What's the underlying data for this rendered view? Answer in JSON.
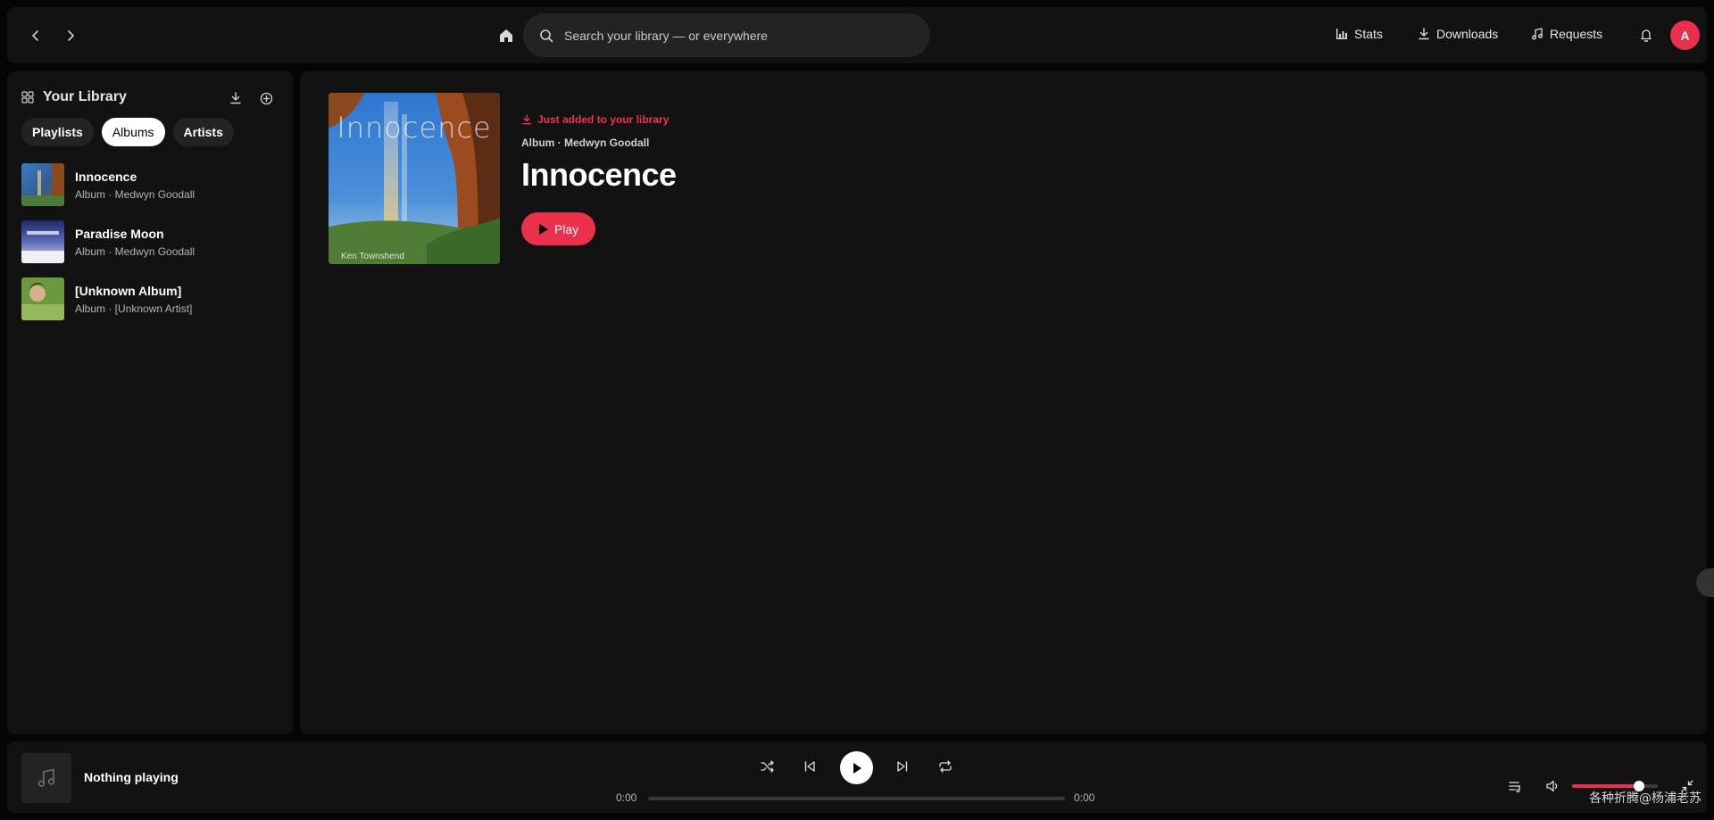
{
  "topbar": {
    "search_placeholder": "Search your library — or everywhere",
    "links": {
      "stats": "Stats",
      "downloads": "Downloads",
      "requests": "Requests"
    },
    "avatar_initial": "A"
  },
  "sidebar": {
    "title": "Your Library",
    "filters": [
      "Playlists",
      "Albums",
      "Artists"
    ],
    "active_filter": "Albums",
    "items": [
      {
        "name": "Innocence",
        "subtitle": "Album · Medwyn Goodall",
        "thumb_icon": "waterfall-cover"
      },
      {
        "name": "Paradise Moon",
        "subtitle": "Album · Medwyn Goodall",
        "thumb_icon": "moon-cover"
      },
      {
        "name": "[Unknown Album]",
        "subtitle": "Album · [Unknown Artist]",
        "thumb_icon": "portrait-cover"
      }
    ]
  },
  "main": {
    "cover_title": "Innocence",
    "cover_artist": "Ken Townshend",
    "added_note": "Just added to your library",
    "meta": "Album · Medwyn Goodall",
    "title": "Innocence",
    "play_label": "Play"
  },
  "player": {
    "now_playing": "Nothing playing",
    "time_elapsed": "0:00",
    "time_total": "0:00",
    "progress": 0,
    "volume": 0.78
  },
  "watermark": "各种折腾@杨浦老苏",
  "colors": {
    "accent": "#ec2f4b",
    "surface": "#121212",
    "background": "#050505"
  }
}
